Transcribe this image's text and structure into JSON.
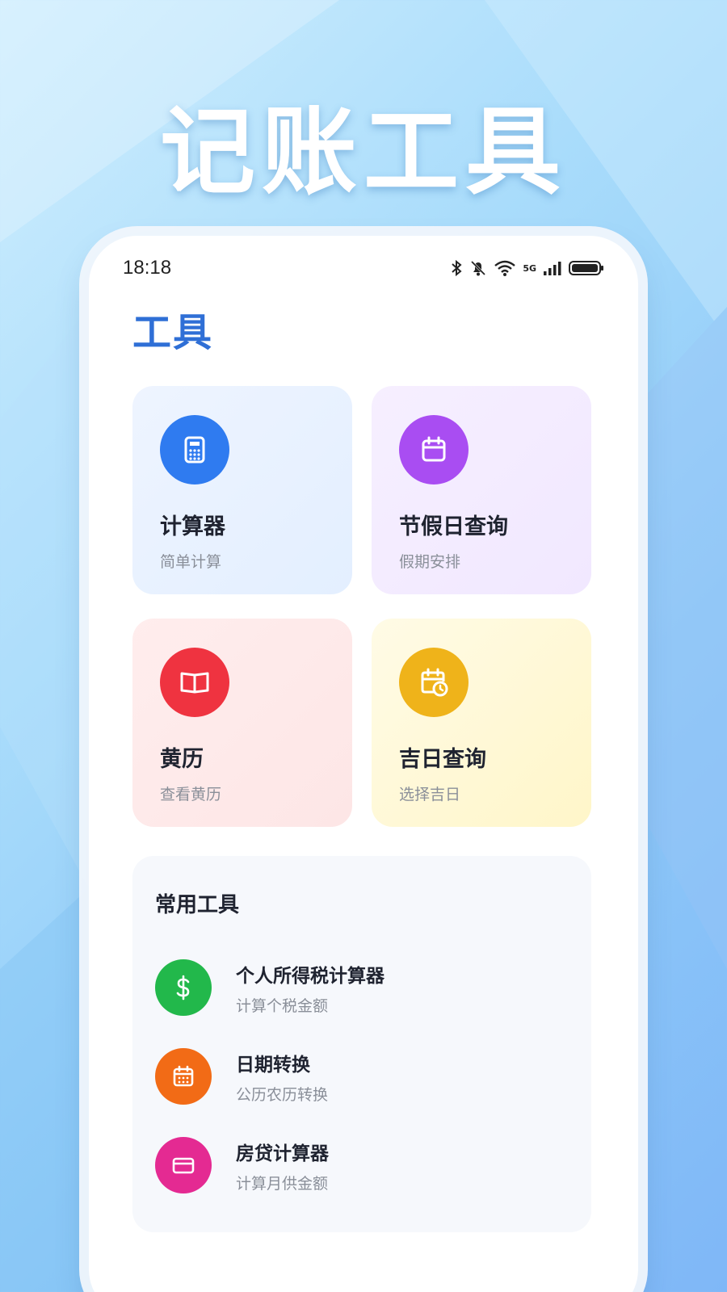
{
  "banner": {
    "title": "记账工具"
  },
  "status_bar": {
    "time": "18:18",
    "network": "5G"
  },
  "page": {
    "title": "工具"
  },
  "cards": [
    {
      "title": "计算器",
      "subtitle": "简单计算",
      "icon": "calculator-icon",
      "color": "#2f7bf0"
    },
    {
      "title": "节假日查询",
      "subtitle": "假期安排",
      "icon": "calendar-icon",
      "color": "#a94df2"
    },
    {
      "title": "黄历",
      "subtitle": "查看黄历",
      "icon": "book-icon",
      "color": "#ef3340"
    },
    {
      "title": "吉日查询",
      "subtitle": "选择吉日",
      "icon": "calendar-clock-icon",
      "color": "#efb31a"
    }
  ],
  "common_tools": {
    "title": "常用工具",
    "items": [
      {
        "title": "个人所得税计算器",
        "subtitle": "计算个税金额",
        "icon": "dollar-icon",
        "color": "#22b84b"
      },
      {
        "title": "日期转换",
        "subtitle": "公历农历转换",
        "icon": "calendar-grid-icon",
        "color": "#f26b16"
      },
      {
        "title": "房贷计算器",
        "subtitle": "计算月供金额",
        "icon": "card-icon",
        "color": "#e42a92"
      }
    ]
  }
}
